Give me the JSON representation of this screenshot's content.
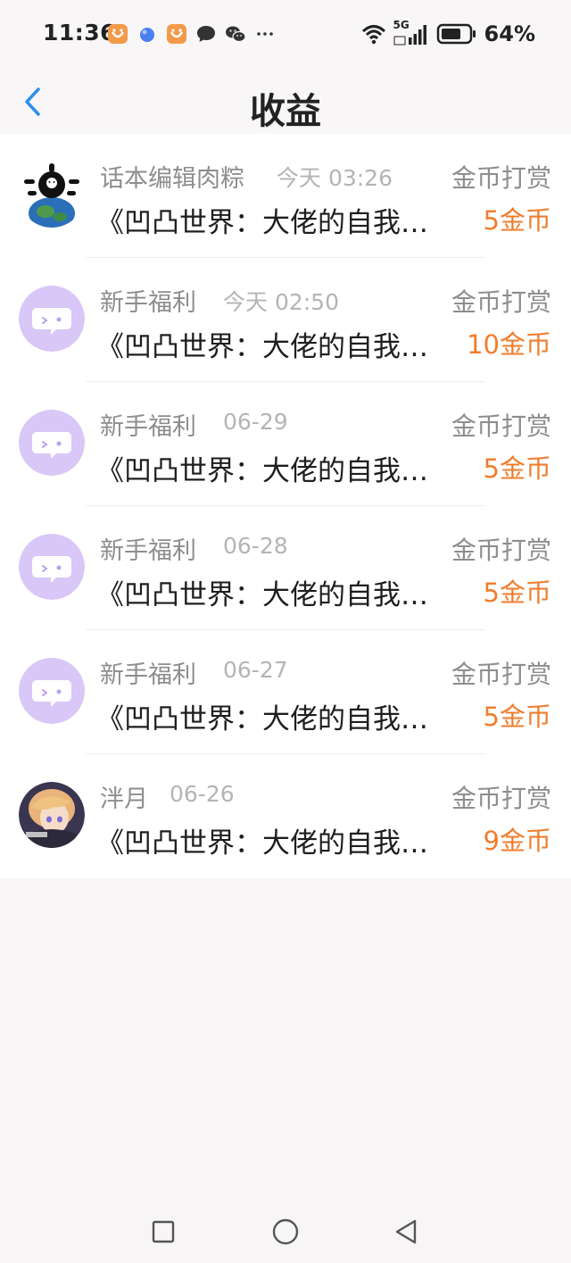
{
  "status_bar": {
    "time": "11:36",
    "network": "5G",
    "battery": "64%",
    "notification_icons": [
      "orange-app-icon",
      "blue-orb-app-icon",
      "orange-app-icon",
      "chat-bubble-icon",
      "wechat-icon",
      "more-dots-icon"
    ]
  },
  "header": {
    "title": "收益",
    "back_icon": "chevron-left-icon"
  },
  "colors": {
    "accent_blue": "#2d8ef0",
    "amount_orange": "#f07d2d",
    "avatar_purple": "#d9c7f7"
  },
  "records": [
    {
      "name": "话本编辑肉粽",
      "time": "今天 03:26",
      "type": "金币打赏",
      "work": "《凹凸世界：大佬的自我救赎》",
      "amount": "5金币",
      "avatar": "editor-avatar"
    },
    {
      "name": "新手福利",
      "time": "今天 02:50",
      "type": "金币打赏",
      "work": "《凹凸世界：大佬的自我救赎》",
      "amount": "10金币",
      "avatar": "welfare-bubble-avatar"
    },
    {
      "name": "新手福利",
      "time": "06-29",
      "type": "金币打赏",
      "work": "《凹凸世界：大佬的自我救赎》",
      "amount": "5金币",
      "avatar": "welfare-bubble-avatar"
    },
    {
      "name": "新手福利",
      "time": "06-28",
      "type": "金币打赏",
      "work": "《凹凸世界：大佬的自我救赎》",
      "amount": "5金币",
      "avatar": "welfare-bubble-avatar"
    },
    {
      "name": "新手福利",
      "time": "06-27",
      "type": "金币打赏",
      "work": "《凹凸世界：大佬的自我救赎》",
      "amount": "5金币",
      "avatar": "welfare-bubble-avatar"
    },
    {
      "name": "泮月",
      "time": "06-26",
      "type": "金币打赏",
      "work": "《凹凸世界：大佬的自我救赎》",
      "amount": "9金币",
      "avatar": "anime-user-avatar"
    }
  ],
  "nav_bar": {
    "buttons": [
      "recents-square-icon",
      "home-circle-icon",
      "back-triangle-icon"
    ]
  }
}
